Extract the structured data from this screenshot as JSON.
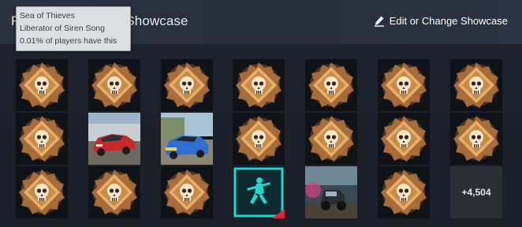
{
  "header": {
    "title": "Rare Achievement Showcase",
    "edit_label": "Edit or Change Showcase",
    "edit_icon": "pencil-icon"
  },
  "tooltip": {
    "game": "Sea of Thieves",
    "achievement": "Liberator of Siren Song",
    "rarity": "0.01% of players have this"
  },
  "grid": {
    "rows": [
      [
        "emblem",
        "emblem",
        "emblem",
        "emblem",
        "emblem",
        "emblem",
        "emblem"
      ],
      [
        "emblem",
        "car-red",
        "car-blue",
        "emblem",
        "emblem",
        "emblem",
        "emblem"
      ],
      [
        "emblem",
        "emblem",
        "emblem",
        "cyan-soldier",
        "offroad-truck",
        "emblem",
        "more"
      ]
    ],
    "more_label": "+4,504"
  },
  "colors": {
    "header_bg": "#262e3a",
    "page_bg": "#1b2028",
    "tooltip_bg": "#dcdedf",
    "emblem_gold": "#d99a4a",
    "cyan_accent": "#22d6d0"
  }
}
